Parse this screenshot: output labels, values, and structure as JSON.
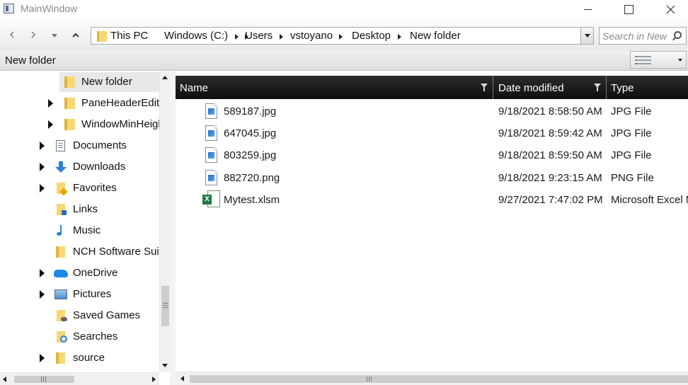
{
  "window": {
    "title": "MainWindow"
  },
  "nav": {
    "breadcrumbs": [
      {
        "label": "This PC"
      },
      {
        "label": "Windows (C:)"
      },
      {
        "label": "Users"
      },
      {
        "label": "vstoyano"
      },
      {
        "label": "Desktop"
      },
      {
        "label": "New folder"
      }
    ],
    "search_placeholder": "Search in New folder"
  },
  "header": {
    "title": "New folder"
  },
  "tree": {
    "items": [
      {
        "label": "New folder",
        "icon": "folder-icon",
        "selected": true
      },
      {
        "label": "PaneHeaderEditor",
        "icon": "folder-icon"
      },
      {
        "label": "WindowMinHeight",
        "icon": "folder-icon"
      },
      {
        "label": "Documents",
        "icon": "documents-icon"
      },
      {
        "label": "Downloads",
        "icon": "downloads-icon"
      },
      {
        "label": "Favorites",
        "icon": "favorites-icon"
      },
      {
        "label": "Links",
        "icon": "links-icon"
      },
      {
        "label": "Music",
        "icon": "music-icon"
      },
      {
        "label": "NCH Software Suite",
        "icon": "folder-icon"
      },
      {
        "label": "OneDrive",
        "icon": "onedrive-icon"
      },
      {
        "label": "Pictures",
        "icon": "pictures-icon"
      },
      {
        "label": "Saved Games",
        "icon": "saved-games-icon"
      },
      {
        "label": "Searches",
        "icon": "searches-icon"
      },
      {
        "label": "source",
        "icon": "folder-icon"
      }
    ]
  },
  "files": {
    "columns": [
      {
        "label": "Name"
      },
      {
        "label": "Date modified"
      },
      {
        "label": "Type"
      }
    ],
    "rows": [
      {
        "name": "589187.jpg",
        "date": "9/18/2021 8:58:50 AM",
        "type": "JPG File",
        "icon": "image-file-icon"
      },
      {
        "name": "647045.jpg",
        "date": "9/18/2021 8:59:42 AM",
        "type": "JPG File",
        "icon": "image-file-icon"
      },
      {
        "name": "803259.jpg",
        "date": "9/18/2021 8:59:50 AM",
        "type": "JPG File",
        "icon": "image-file-icon"
      },
      {
        "name": "882720.png",
        "date": "9/18/2021 9:23:15 AM",
        "type": "PNG File",
        "icon": "image-file-icon"
      },
      {
        "name": "Mytest.xlsm",
        "date": "9/27/2021 7:47:02 PM",
        "type": "Microsoft Excel Macro-Enabled Worksheet",
        "icon": "excel-file-icon"
      }
    ]
  }
}
